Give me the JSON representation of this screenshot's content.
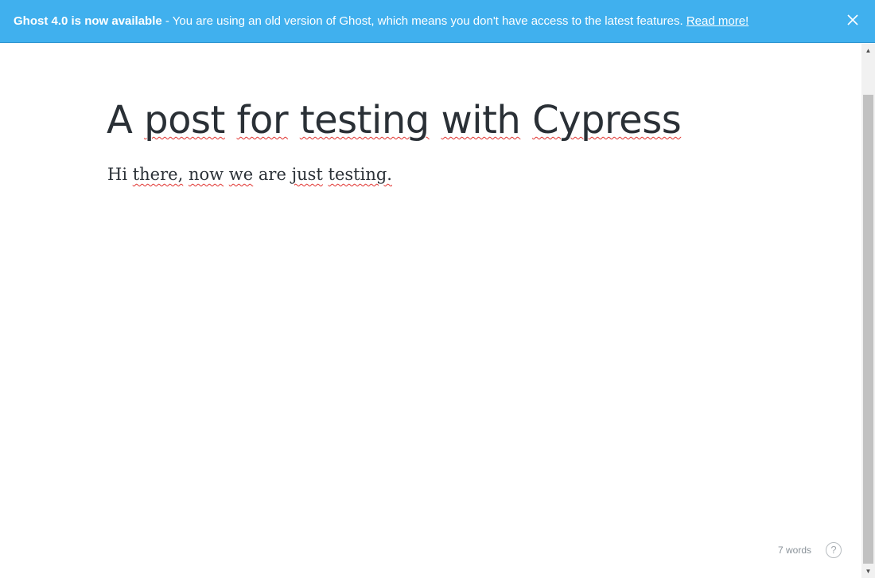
{
  "banner": {
    "headline": "Ghost 4.0 is now available",
    "message": " - You are using an old version of Ghost, which means you don't have access to the latest features. ",
    "link_label": "Read more!",
    "color": "#40b0ee",
    "close_icon": "close-icon"
  },
  "post": {
    "title_words": [
      "A",
      "post",
      "for",
      "testing",
      "with",
      "Cypress"
    ],
    "body_words": [
      "Hi",
      "there,",
      "now",
      "we",
      "are",
      "just",
      "testing."
    ]
  },
  "footer": {
    "word_count": "7 words",
    "help_label": "?"
  },
  "scrollbar": {
    "up_arrow": "▲",
    "down_arrow": "▼"
  }
}
